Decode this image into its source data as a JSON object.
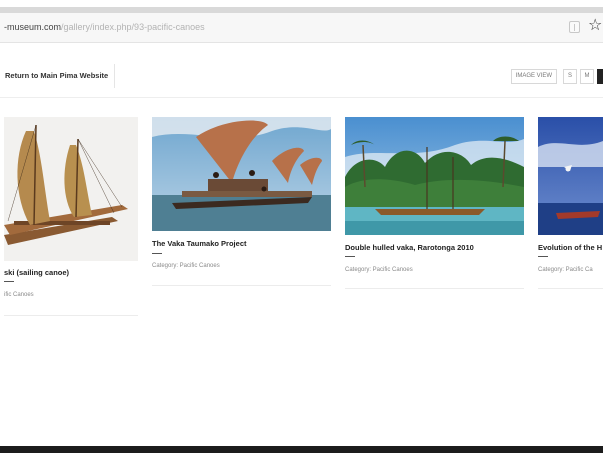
{
  "browser": {
    "url_domain": "-museum.com",
    "url_path": "/gallery/index.php/93-pacific-canoes",
    "bookmark_icon": "reading-list-icon",
    "star_icon": "star-icon",
    "star_glyph": "☆"
  },
  "header": {
    "return_label": "Return to Main Pima Website",
    "image_view_label": "IMAGE VIEW",
    "size_small": "S",
    "size_medium": "M"
  },
  "gallery": {
    "items": [
      {
        "title": "ski (sailing canoe)",
        "category": "ific Canoes"
      },
      {
        "title": "The Vaka Taumako Project",
        "category": "Category: Pacific Canoes"
      },
      {
        "title": "Double hulled vaka, Rarotonga 2010",
        "category": "Category: Pacific Canoes"
      },
      {
        "title": "Evolution of the H",
        "category": "Category: Pacific Ca"
      }
    ]
  },
  "colors": {
    "accent_dark": "#222222",
    "chrome_bar": "#d9d9d9",
    "bottom_bar": "#1c1c1c"
  }
}
